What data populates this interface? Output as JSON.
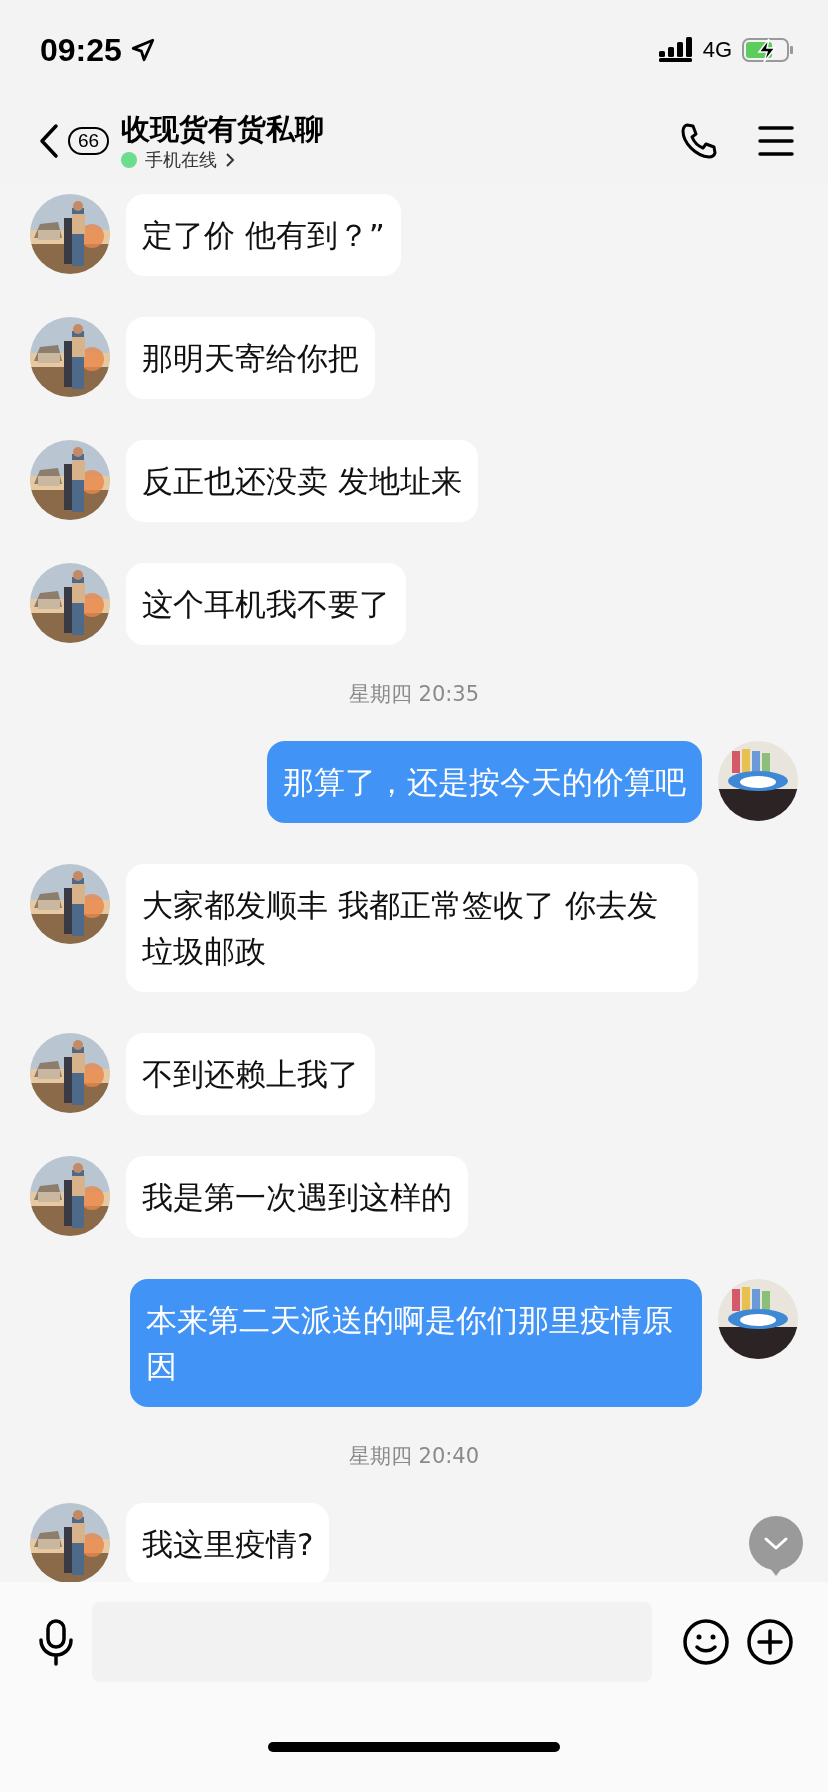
{
  "status_bar": {
    "time": "09:25",
    "network": "4G"
  },
  "header": {
    "unread_count": "66",
    "title": "收现货有货私聊",
    "presence": "手机在线",
    "online": true
  },
  "messages": [
    {
      "kind": "incoming",
      "text": "定了价 他有到？”"
    },
    {
      "kind": "incoming",
      "text": "那明天寄给你把"
    },
    {
      "kind": "incoming",
      "text": "反正也还没卖 发地址来"
    },
    {
      "kind": "incoming",
      "text": "这个耳机我不要了"
    },
    {
      "kind": "time",
      "text": "星期四 20:35"
    },
    {
      "kind": "outgoing",
      "text": "那算了，还是按今天的价算吧"
    },
    {
      "kind": "incoming",
      "text": "大家都发顺丰 我都正常签收了 你去发垃圾邮政"
    },
    {
      "kind": "incoming",
      "text": "不到还赖上我了"
    },
    {
      "kind": "incoming",
      "text": "我是第一次遇到这样的"
    },
    {
      "kind": "outgoing",
      "text": "本来第二天派送的啊是你们那里疫情原因"
    },
    {
      "kind": "time",
      "text": "星期四 20:40"
    },
    {
      "kind": "incoming",
      "text": "我这里疫情?"
    }
  ]
}
